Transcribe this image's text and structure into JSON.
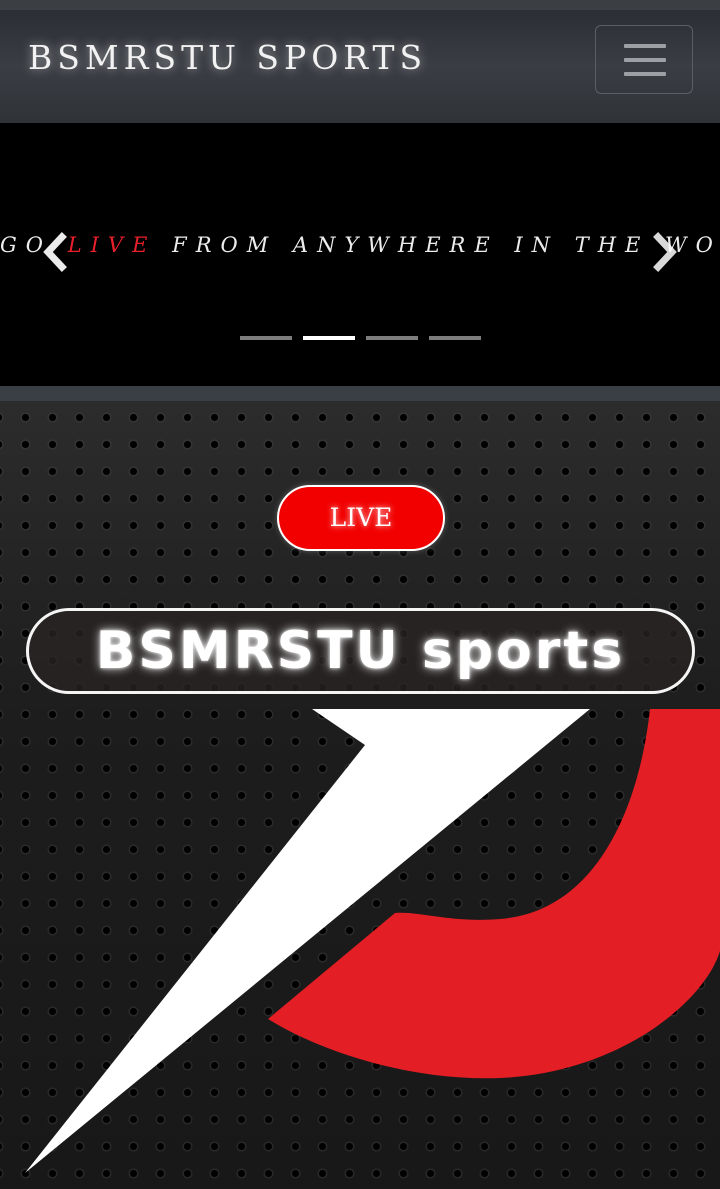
{
  "navbar": {
    "brand": "BSMRSTU SPORTS",
    "menu_icon": "hamburger-menu-icon"
  },
  "carousel": {
    "slide_text_prefix": "GO",
    "slide_text_highlight": "LIVE",
    "slide_text_suffix": "FROM ANYWHERE IN THE WORLD",
    "prev_icon": "chevron-left-icon",
    "next_icon": "chevron-right-icon",
    "indicator_count": 4,
    "active_indicator": 2
  },
  "hero": {
    "live_button": "LIVE",
    "title": "BSMRSTU sports",
    "logo_icon": "sports-logo-icon"
  },
  "colors": {
    "accent_red": "#e8202a",
    "live_button_red": "#f20000",
    "logo_red": "#e31e24",
    "navbar": "#2f3338"
  }
}
